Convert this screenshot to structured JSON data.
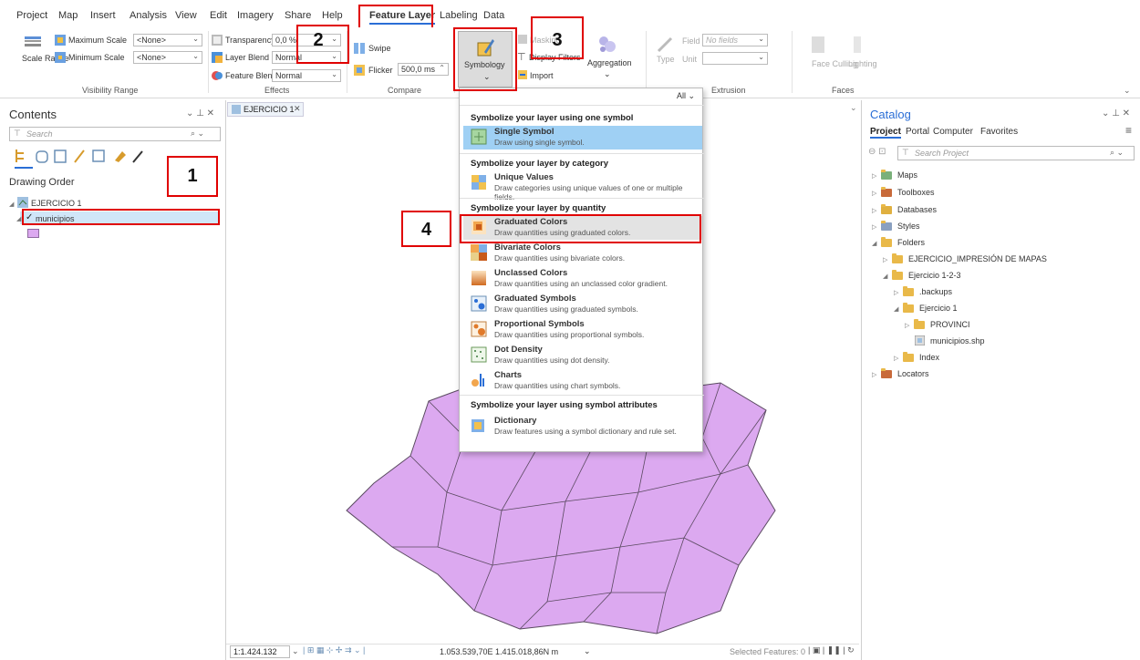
{
  "menu": {
    "items": [
      "Project",
      "Map",
      "Insert",
      "Analysis",
      "View",
      "Edit",
      "Imagery",
      "Share",
      "Help",
      "Feature Layer",
      "Labeling",
      "Data"
    ]
  },
  "ribbon": {
    "max_scale_label": "Maximum Scale",
    "min_scale_label": "Minimum Scale",
    "max_scale_value": "<None>",
    "min_scale_value": "<None>",
    "scale_range_label": "Scale Range",
    "visibility_range_group": "Visibility Range",
    "transparency_label": "Transparency",
    "transparency_value": "0,0 %",
    "layer_blend_label": "Layer Blend",
    "layer_blend_value": "Normal",
    "feature_blend_label": "Feature Blend",
    "feature_blend_value": "Normal",
    "effects_group": "Effects",
    "swipe_label": "Swipe",
    "flicker_label": "Flicker",
    "flicker_value": "500,0 ms",
    "compare_group": "Compare",
    "symbology_label": "Symbology",
    "masking_label": "Masking",
    "display_filters_label": "Display Filters",
    "import_label": "Import",
    "aggregation_label": "Aggregation",
    "type_label": "Type",
    "field_label": "Field",
    "field_value": "No fields",
    "unit_label": "Unit",
    "extrusion_group": "Extrusion",
    "face_culling_label": "Face Culling",
    "lighting_label": "Lighting",
    "faces_group": "Faces"
  },
  "contents": {
    "title": "Contents",
    "search_placeholder": "Search",
    "drawing_order": "Drawing Order",
    "map_name": "EJERCICIO 1",
    "layer_name": "municipios"
  },
  "map_tab": {
    "label": "EJERCICIO 1"
  },
  "dropdown": {
    "filter_label": "All",
    "sections": [
      {
        "heading": "Symbolize your layer using one symbol",
        "options": [
          {
            "title": "Single Symbol",
            "desc": "Draw using single symbol."
          }
        ]
      },
      {
        "heading": "Symbolize your layer by category",
        "options": [
          {
            "title": "Unique Values",
            "desc": "Draw categories using unique values of one or multiple fields."
          }
        ]
      },
      {
        "heading": "Symbolize your layer by quantity",
        "options": [
          {
            "title": "Graduated Colors",
            "desc": "Draw quantities using graduated colors."
          },
          {
            "title": "Bivariate Colors",
            "desc": "Draw quantities using bivariate colors."
          },
          {
            "title": "Unclassed Colors",
            "desc": "Draw quantities using an unclassed color gradient."
          },
          {
            "title": "Graduated Symbols",
            "desc": "Draw quantities using graduated symbols."
          },
          {
            "title": "Proportional Symbols",
            "desc": "Draw quantities using proportional symbols."
          },
          {
            "title": "Dot Density",
            "desc": "Draw quantities using dot density."
          },
          {
            "title": "Charts",
            "desc": "Draw quantities using chart symbols."
          }
        ]
      },
      {
        "heading": "Symbolize your layer using symbol attributes",
        "options": [
          {
            "title": "Dictionary",
            "desc": "Draw features using a symbol dictionary and rule set."
          }
        ]
      }
    ]
  },
  "catalog": {
    "title": "Catalog",
    "tabs": [
      "Project",
      "Portal",
      "Computer",
      "Favorites"
    ],
    "search_placeholder": "Search Project",
    "tree": {
      "maps": "Maps",
      "toolboxes": "Toolboxes",
      "databases": "Databases",
      "styles": "Styles",
      "folders": "Folders",
      "ejercicio_impresion": "EJERCICIO_IMPRESIÓN DE MAPAS",
      "ejercicio_123": "Ejercicio 1-2-3",
      "backups": ".backups",
      "ejercicio1": "Ejercicio 1",
      "provinci": "PROVINCI",
      "municipios_shp": "municipios.shp",
      "index": "Index",
      "locators": "Locators"
    }
  },
  "status": {
    "scale": "1:1.424.132",
    "coords": "1.053.539,70E 1.415.018,86N m",
    "selected": "Selected Features: 0"
  },
  "callouts": [
    "1",
    "2",
    "3",
    "4"
  ],
  "colors": {
    "accent": "#2a6ed6",
    "highlight": "#9fd0f4",
    "polygon_fill": "#dca9f0",
    "callout": "#e00000"
  }
}
